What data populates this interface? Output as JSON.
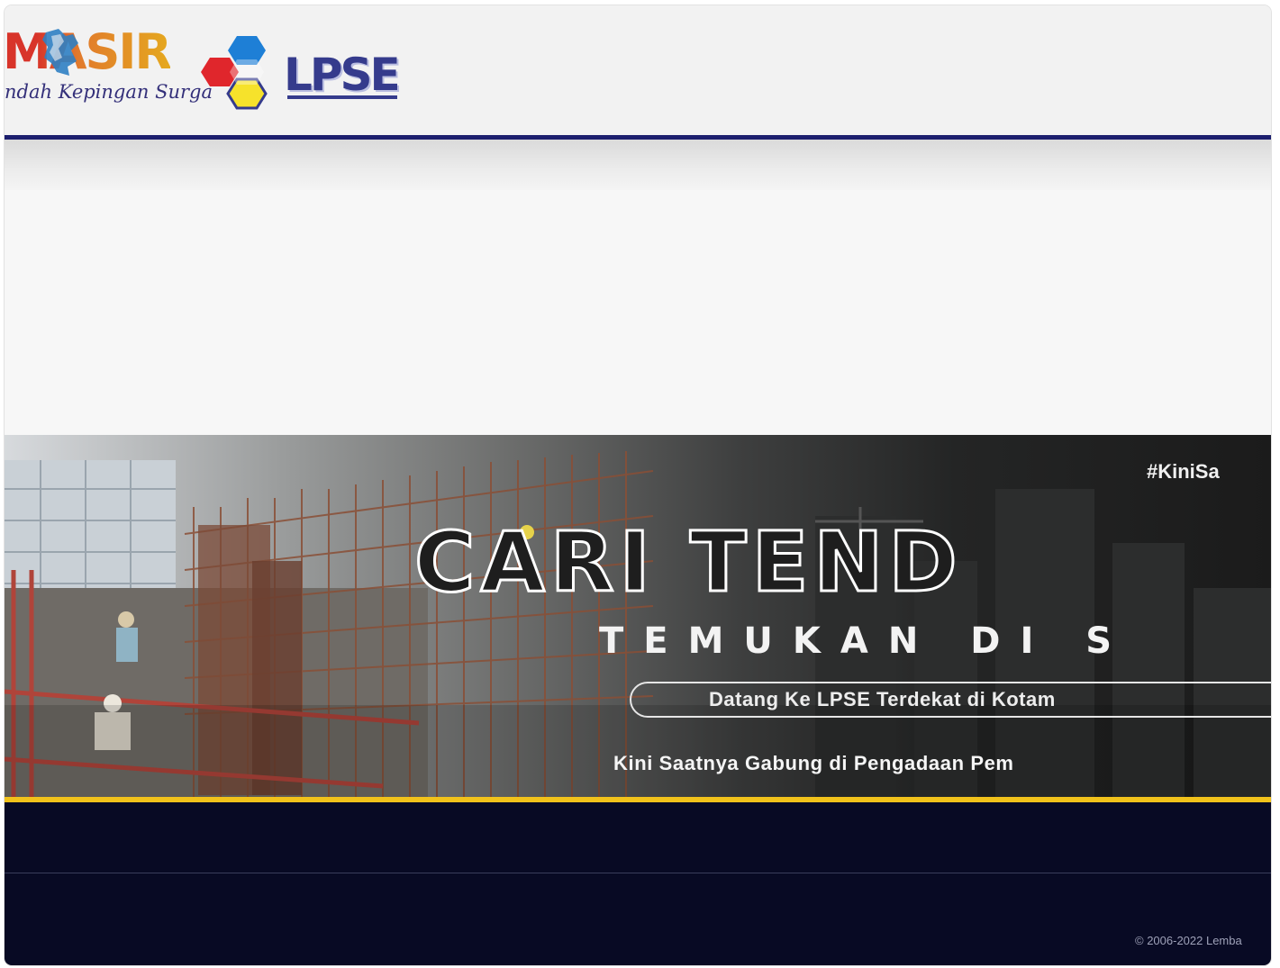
{
  "header": {
    "masir_logo": {
      "word": "MASIR",
      "tagline": "ndah Kepingan Surga"
    },
    "lpse_logo": {
      "word": "LPSE"
    }
  },
  "banner": {
    "hashtag": "#KiniSa",
    "title": "CARI TEND",
    "subtitle": "TEMUKAN DI S",
    "pill_text": "Datang Ke LPSE Terdekat di Kotam",
    "tagline": "Kini Saatnya Gabung di Pengadaan Pem"
  },
  "footer": {
    "copyright": "© 2006-2022 Lemba"
  },
  "colors": {
    "header_line": "#1c1f6e",
    "gold_line": "#f1c21b",
    "footer_bg": "#080a24",
    "lpse_text": "#353b8c",
    "hex_red": "#e0262c",
    "hex_blue": "#1e7fd6",
    "hex_yellow": "#f6e22b"
  }
}
